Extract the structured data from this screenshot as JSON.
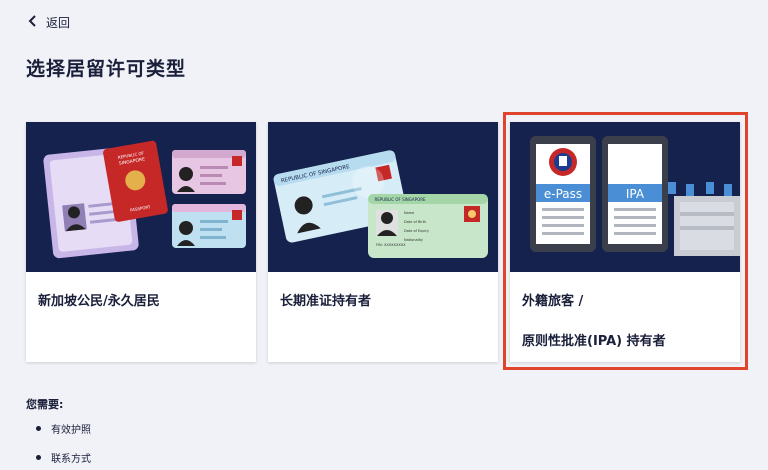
{
  "nav": {
    "back_label": "返回"
  },
  "page": {
    "title": "选择居留许可类型"
  },
  "cards": [
    {
      "label_lines": [
        "新加坡公民/永久居民"
      ]
    },
    {
      "label_lines": [
        "长期准证持有者"
      ]
    },
    {
      "label_lines": [
        "外籍旅客 /",
        "原则性批准(IPA) 持有者"
      ]
    }
  ],
  "illustration_text": {
    "passport_top": "REPUBLIC OF",
    "passport_country": "SINGAPORE",
    "passport_word": "PASSPORT",
    "card_header": "REPUBLIC OF SINGAPORE",
    "fin_label": "FIN: XXXXXXXXX",
    "card_fields": [
      "Name",
      "Date of Birth",
      "Date of Expiry",
      "Nationality"
    ],
    "epass_label": "e-Pass",
    "ipa_label": "IPA"
  },
  "requirements": {
    "title": "您需要:",
    "items": [
      "有效护照",
      "联系方式"
    ]
  },
  "colors": {
    "page_bg": "#f0f2f7",
    "illustration_bg": "#16224e",
    "text": "#1a1f3a",
    "highlight": "#e0442c",
    "accent_blue": "#4a8fd6",
    "passport_red": "#c62828"
  }
}
